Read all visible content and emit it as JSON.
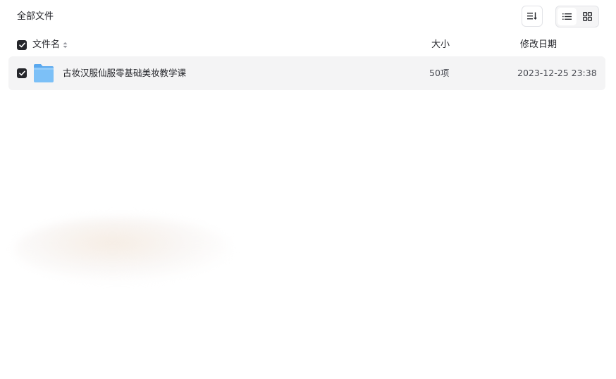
{
  "breadcrumb": {
    "label": "全部文件"
  },
  "toolbar": {
    "sort_icon": "sort-list-icon",
    "view_list_icon": "list-view-icon",
    "view_grid_icon": "grid-view-icon",
    "active_view": "list"
  },
  "columns": {
    "name": "文件名",
    "size": "大小",
    "modified": "修改日期"
  },
  "files": [
    {
      "name": "古妆汉服仙服零基础美妆教学课",
      "type_icon": "folder-icon",
      "size": "50项",
      "modified": "2023-12-25 23:38",
      "checked": true
    }
  ],
  "colors": {
    "text": "#25262b",
    "row_bg": "#f4f4f5",
    "folder": "#6cb6f5"
  }
}
